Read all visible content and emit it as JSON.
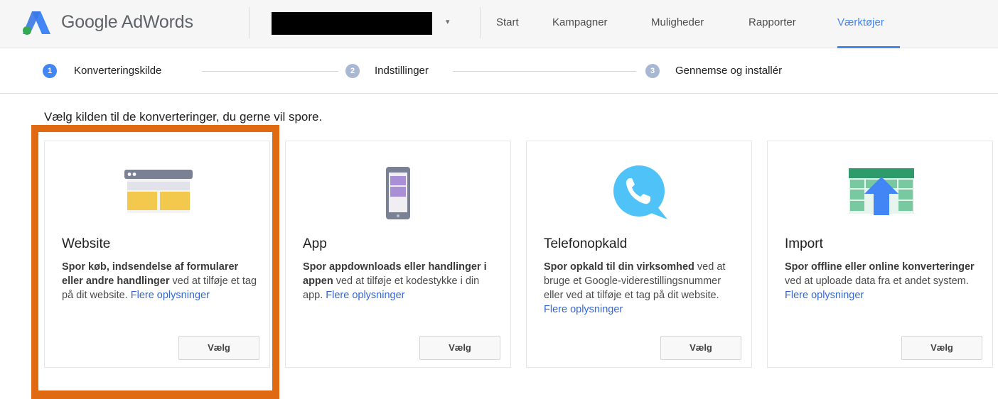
{
  "header": {
    "brand": "Google AdWords",
    "nav": [
      {
        "label": "Start"
      },
      {
        "label": "Kampagner"
      },
      {
        "label": "Muligheder"
      },
      {
        "label": "Rapporter"
      },
      {
        "label": "Værktøjer",
        "active": true
      }
    ],
    "caret": "▾"
  },
  "stepper": {
    "steps": [
      {
        "number": "1",
        "label": "Konverteringskilde",
        "color": "#4285f4"
      },
      {
        "number": "2",
        "label": "Indstillinger",
        "color": "#a9b8d2"
      },
      {
        "number": "3",
        "label": "Gennemse og installér",
        "color": "#a9b8d2"
      }
    ]
  },
  "instruction": "Vælg kilden til de konverteringer, du gerne vil spore.",
  "cards": [
    {
      "title": "Website",
      "desc_bold": "Spor køb, indsendelse af formularer eller andre handlinger",
      "desc_text": " ved at tilføje et tag på dit website. ",
      "desc_link": "Flere oplysninger",
      "button": "Vælg",
      "icon": "browser-window-icon"
    },
    {
      "title": "App",
      "desc_bold": "Spor appdownloads eller handlinger i appen",
      "desc_text": " ved at tilføje et kodestykke i din app. ",
      "desc_link": "Flere oplysninger",
      "button": "Vælg",
      "icon": "mobile-phone-icon"
    },
    {
      "title": "Telefonopkald",
      "desc_bold": "Spor opkald til din virksomhed",
      "desc_text": " ved at bruge et Google-viderestillingsnummer eller ved at tilføje et tag på dit website. ",
      "desc_link": "Flere oplysninger",
      "button": "Vælg",
      "icon": "phone-call-bubble-icon"
    },
    {
      "title": "Import",
      "desc_bold": "Spor offline eller online konverteringer",
      "desc_text": " ved at uploade data fra et andet system. ",
      "desc_link": "Flere oplysninger",
      "button": "Vælg",
      "icon": "spreadsheet-upload-icon"
    }
  ],
  "colors": {
    "accent": "#4285f4",
    "link": "#3367d6",
    "highlight": "#e06a12"
  }
}
